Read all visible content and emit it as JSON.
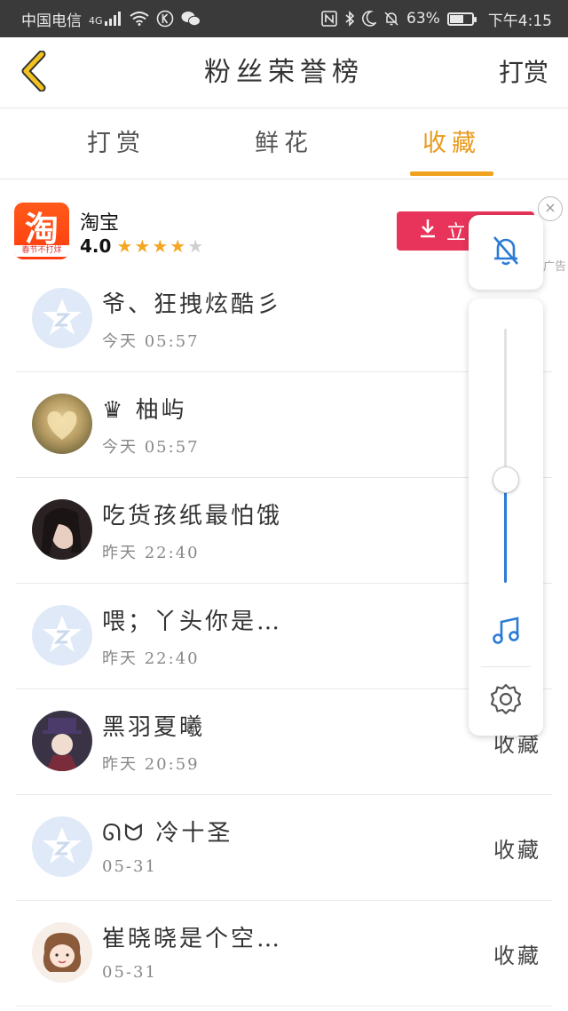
{
  "status_bar": {
    "carrier": "中国电信",
    "network": "4G",
    "battery_percent": "63%",
    "battery_level": 0.63,
    "time": "下午4:15"
  },
  "header": {
    "title": "粉丝荣誉榜",
    "right_action": "打赏"
  },
  "tabs": [
    {
      "label": "打赏",
      "active": false
    },
    {
      "label": "鲜花",
      "active": false
    },
    {
      "label": "收藏",
      "active": true
    }
  ],
  "ad": {
    "app_name": "淘宝",
    "logo_text": "淘",
    "logo_subtext": "春节不打烊",
    "rating": "4.0",
    "stars": 4,
    "button_label": "立",
    "close_label": "×",
    "ad_tag": "广告"
  },
  "list": [
    {
      "name": "爷、狂拽炫酷彡",
      "time": "今天 05:57",
      "action": "",
      "avatar": "default"
    },
    {
      "name": "♛ 柚屿",
      "time": "今天 05:57",
      "action": "",
      "avatar": "photo-heart"
    },
    {
      "name": "吃货孩纸最怕饿",
      "time": "昨天 22:40",
      "action": "",
      "avatar": "photo-girl"
    },
    {
      "name": "喂；丫头你是…",
      "time": "昨天 22:40",
      "action": "",
      "avatar": "default"
    },
    {
      "name": "黑羽夏曦",
      "time": "昨天 20:59",
      "action": "收藏",
      "avatar": "photo-anime"
    },
    {
      "name": "ᘏᗢ 冷十圣",
      "time": "05-31",
      "action": "收藏",
      "avatar": "default"
    },
    {
      "name": "崔晓晓是个空…",
      "time": "05-31",
      "action": "收藏",
      "avatar": "photo-cartoon"
    }
  ],
  "overlay": {
    "volume_level": 0.4,
    "accent_color": "#2a7ad6"
  },
  "colors": {
    "tab_active": "#e99a1c",
    "ad_button": "#e8345a",
    "status_bar_bg": "#3a3a3a"
  }
}
